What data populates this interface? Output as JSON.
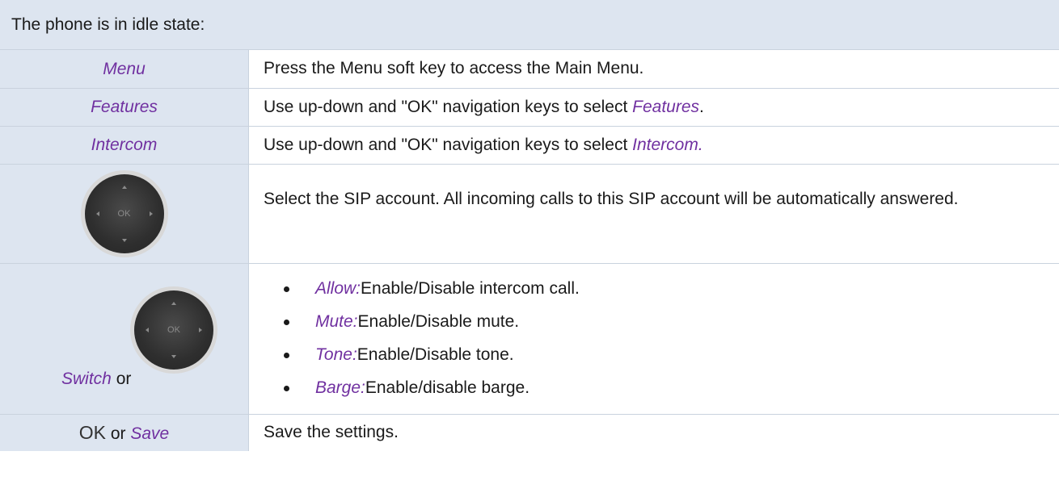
{
  "header": {
    "text": "The phone is in idle state:"
  },
  "rows": [
    {
      "left": "Menu",
      "right": "Press the Menu soft key to access the Main Menu."
    },
    {
      "left": "Features",
      "right_pre": "Use up-down and \"OK\" navigation keys to select ",
      "right_em": "Features",
      "right_post": "."
    },
    {
      "left": "Intercom",
      "right_pre": "Use up-down and \"OK\" navigation keys to select ",
      "right_em": "Intercom.",
      "right_post": ""
    },
    {
      "nav_ok": "OK",
      "right": "Select the SIP account. All incoming calls to this SIP account will be automatically answered."
    },
    {
      "left_italic": "Switch",
      "left_or": " or",
      "nav_ok": "OK",
      "bullets": [
        {
          "label": "Allow:",
          "text": " Enable/Disable intercom call."
        },
        {
          "label": "Mute:",
          "text": " Enable/Disable mute."
        },
        {
          "label": "Tone:",
          "text": " Enable/Disable tone."
        },
        {
          "label": "Barge:",
          "text": " Enable/disable barge."
        }
      ]
    },
    {
      "left_ok": "OK",
      "left_or": " or ",
      "left_italic": "Save",
      "right": "Save the settings."
    }
  ],
  "colors": {
    "header_bg": "#dde5f0",
    "italic_accent": "#7030a0",
    "border": "#c9d2de"
  }
}
